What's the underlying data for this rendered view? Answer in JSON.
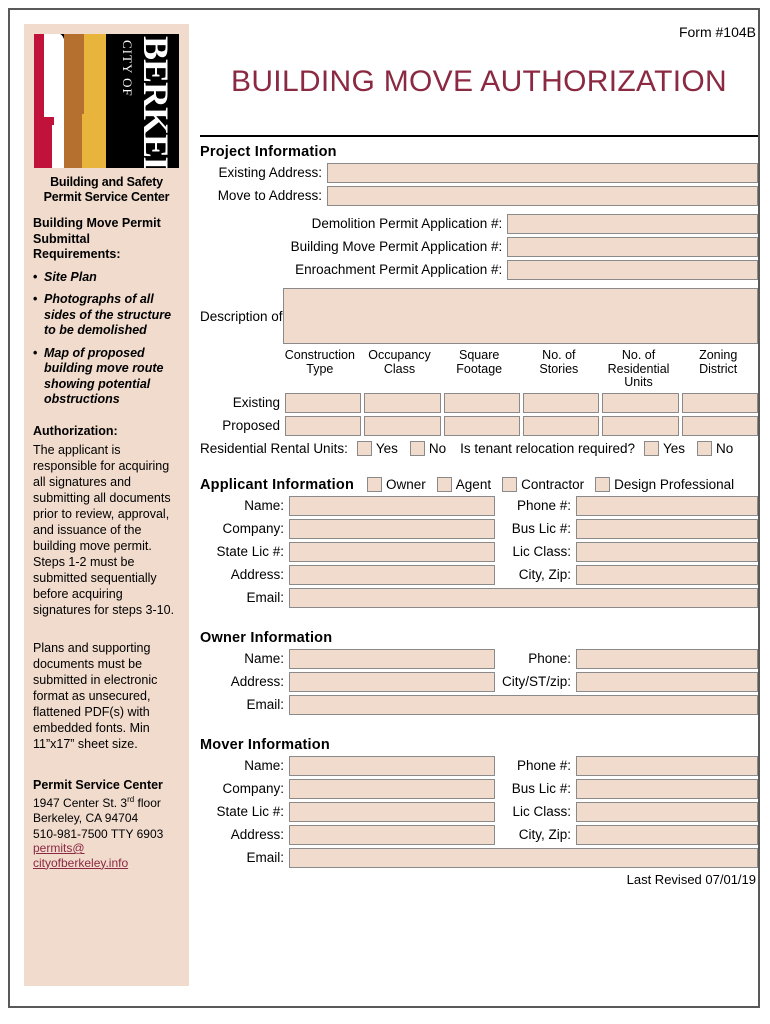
{
  "form_number": "Form #104B",
  "title": "BUILDING MOVE AUTHORIZATION",
  "colors": {
    "title": "#8b2942",
    "field_fill": "#f0dbcd",
    "field_border": "#8a8a8a",
    "sidebar_bg": "#f0dbcd",
    "link": "#8b2942"
  },
  "sidebar": {
    "logo": {
      "city_of": "CITY OF",
      "berkeley": "BERKELEY"
    },
    "org_line1": "Building and Safety",
    "org_line2": "Permit Service Center",
    "requirements_heading": "Building Move Permit Submittal Requirements:",
    "requirements": [
      "Site Plan",
      "Photographs of all sides of the structure to be demolished",
      "Map of proposed building move route showing potential obstructions"
    ],
    "authorization_heading": "Authorization:",
    "authorization_text": "The applicant is responsible for acquiring all signatures and submitting all documents prior to review, approval, and issuance of the building move permit. Steps 1-2 must be submitted sequentially before acquiring signatures for steps 3-10.",
    "plans_text": "Plans and supporting documents must be submitted in electronic format as unsecured, flattened PDF(s) with embedded fonts. Min 11”x17” sheet size.",
    "psc_heading": "Permit Service Center",
    "psc_address1_pre": "1947 Center St. 3",
    "psc_address1_sup": "rd",
    "psc_address1_post": " floor",
    "psc_address2": "Berkeley, CA 94704",
    "psc_phone": "510-981-7500  TTY 6903",
    "psc_email_line1": "permits@",
    "psc_email_line2": "cityofberkeley.info"
  },
  "project": {
    "section_title": "Project Information",
    "existing_address_label": "Existing Address:",
    "move_to_address_label": "Move to Address:",
    "demolition_label": "Demolition Permit Application #:",
    "building_move_label": "Building Move Permit Application #:",
    "enroachment_label": "Enroachment Permit Application #:",
    "description_label": "Description of Move:",
    "existing_address_value": "",
    "move_to_address_value": "",
    "demolition_value": "",
    "building_move_value": "",
    "enroachment_value": "",
    "description_value": ""
  },
  "table": {
    "columns": [
      "Construction Type",
      "Occupancy Class",
      "Square Footage",
      "No. of Stories",
      "No. of Residential Units",
      "Zoning District"
    ],
    "rows": [
      {
        "label": "Existing",
        "values": [
          "",
          "",
          "",
          "",
          "",
          ""
        ]
      },
      {
        "label": "Proposed",
        "values": [
          "",
          "",
          "",
          "",
          "",
          ""
        ]
      }
    ]
  },
  "rental": {
    "label": "Residential Rental Units:",
    "yes": "Yes",
    "no": "No",
    "relocation_label": "Is tenant relocation required?",
    "relocation_yes": "Yes",
    "relocation_no": "No"
  },
  "applicant": {
    "section_title": "Applicant Information",
    "types": [
      "Owner",
      "Agent",
      "Contractor",
      "Design Professional"
    ],
    "fields": [
      {
        "l1": "Name:",
        "v1": "",
        "l2": "Phone #:",
        "v2": ""
      },
      {
        "l1": "Company:",
        "v1": "",
        "l2": "Bus Lic #:",
        "v2": ""
      },
      {
        "l1": "State Lic #:",
        "v1": "",
        "l2": "Lic Class:",
        "v2": ""
      },
      {
        "l1": "Address:",
        "v1": "",
        "l2": "City, Zip:",
        "v2": ""
      }
    ],
    "email_label": "Email:",
    "email_value": ""
  },
  "owner": {
    "section_title": "Owner Information",
    "fields": [
      {
        "l1": "Name:",
        "v1": "",
        "l2": "Phone:",
        "v2": ""
      },
      {
        "l1": "Address:",
        "v1": "",
        "l2": "City/ST/zip:",
        "v2": ""
      }
    ],
    "email_label": "Email:",
    "email_value": ""
  },
  "mover": {
    "section_title": "Mover Information",
    "fields": [
      {
        "l1": "Name:",
        "v1": "",
        "l2": "Phone #:",
        "v2": ""
      },
      {
        "l1": "Company:",
        "v1": "",
        "l2": "Bus Lic #:",
        "v2": ""
      },
      {
        "l1": "State Lic #:",
        "v1": "",
        "l2": "Lic Class:",
        "v2": ""
      },
      {
        "l1": "Address:",
        "v1": "",
        "l2": "City, Zip:",
        "v2": ""
      }
    ],
    "email_label": "Email:",
    "email_value": ""
  },
  "footer": {
    "last_revised": "Last Revised 07/01/19"
  }
}
